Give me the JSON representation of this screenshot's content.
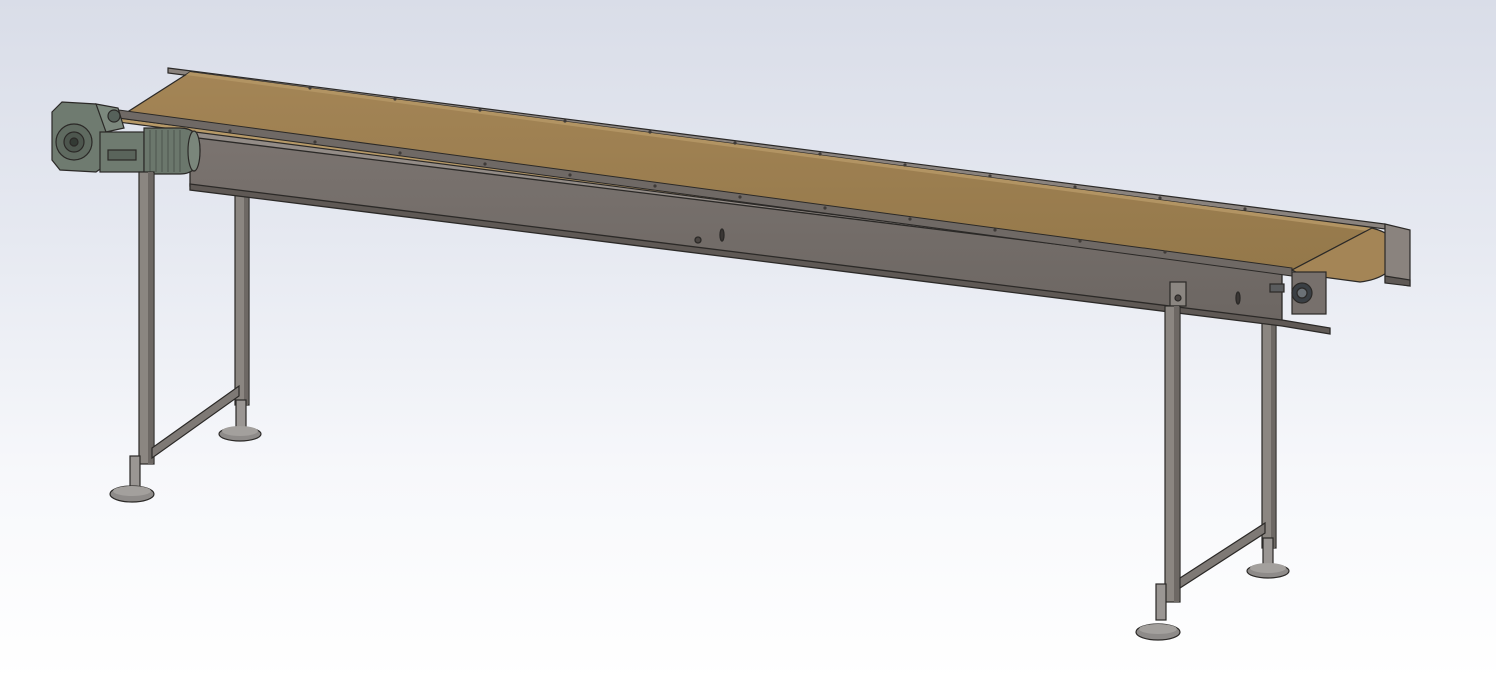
{
  "scene": {
    "subject": "belt-conveyor",
    "colors": {
      "background_top": "#d9dde8",
      "background_bottom": "#ffffff",
      "belt": "#9c7f4f",
      "belt_edge": "#b79a68",
      "frame": "#77706c",
      "frame_dark": "#5f5955",
      "leg": "#8b8681",
      "motor": "#6f7b70",
      "foot": "#8e8b89",
      "outline": "#2b2927"
    },
    "parts": [
      "conveyor-belt",
      "side-frame",
      "drive-motor",
      "gearbox",
      "tail-pulley",
      "support-legs",
      "leveling-feet"
    ]
  }
}
